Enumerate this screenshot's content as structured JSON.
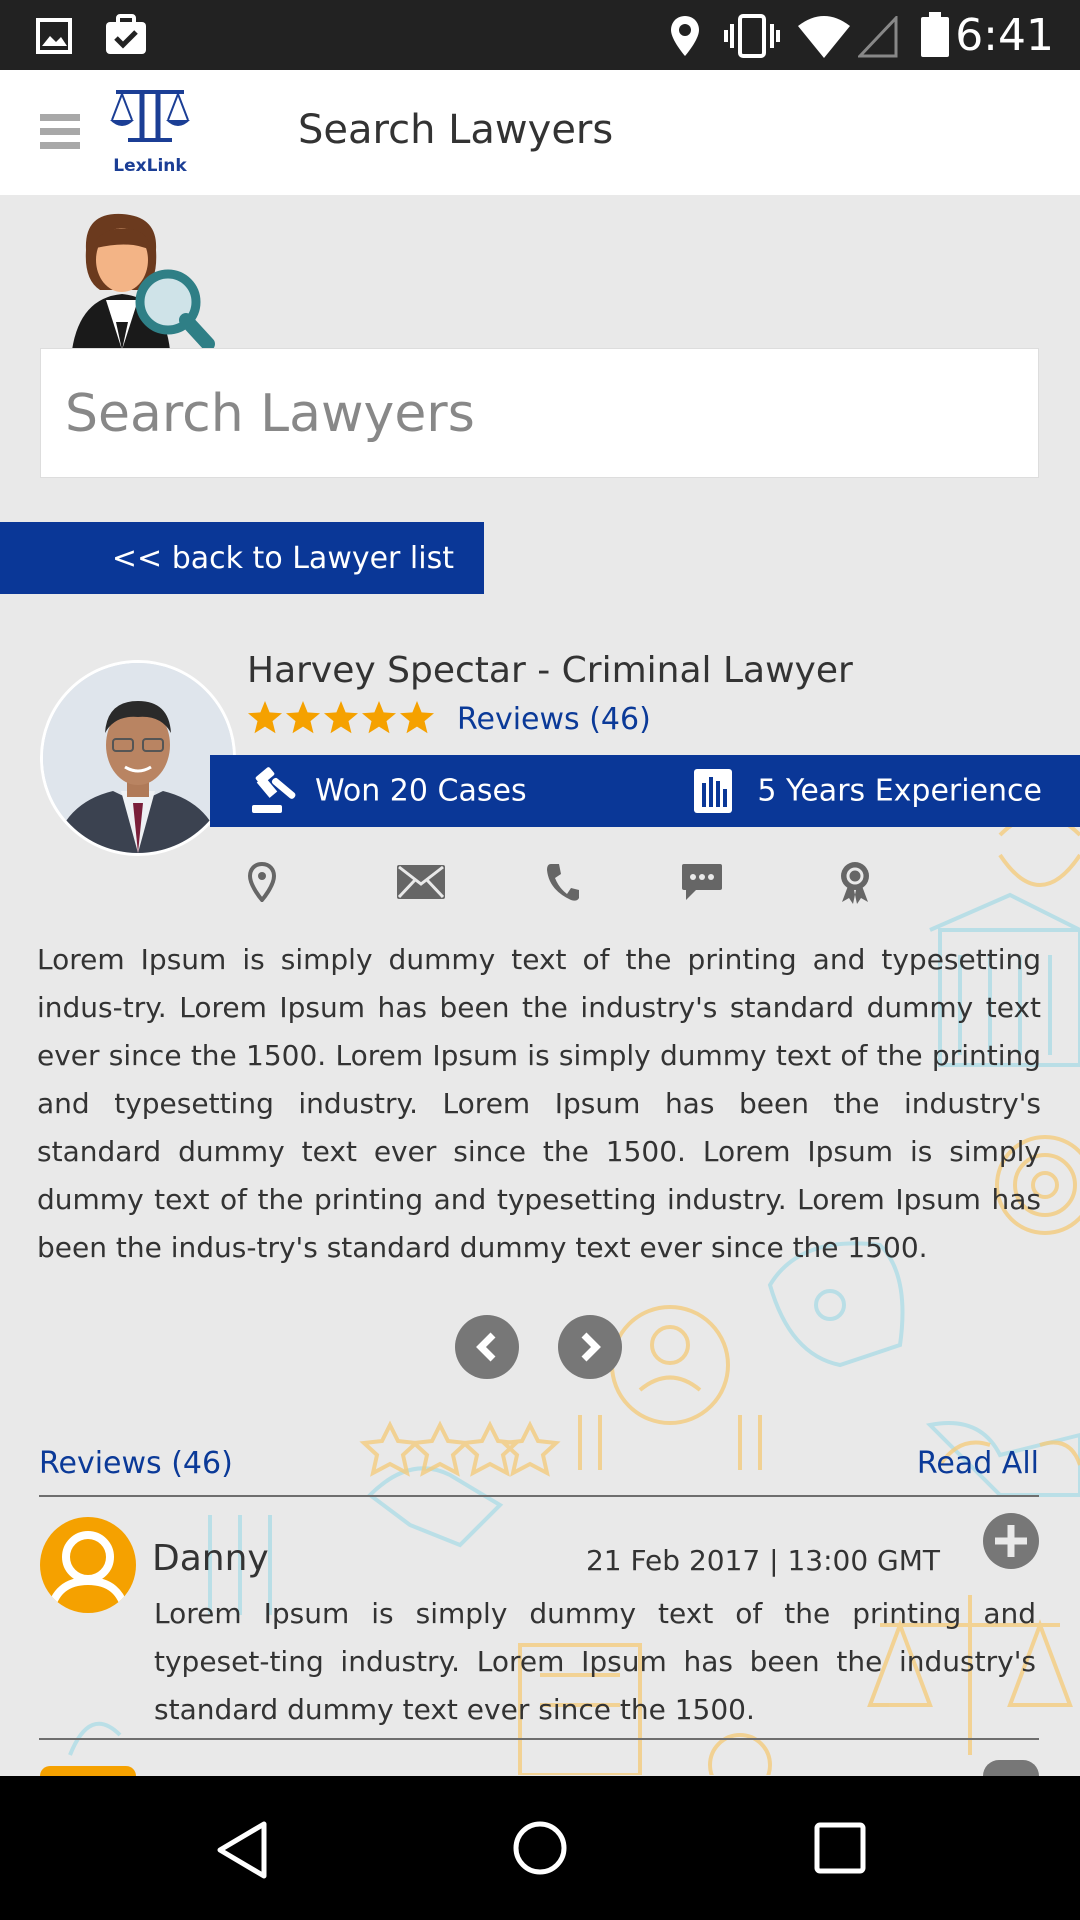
{
  "status_bar": {
    "time": "6:41"
  },
  "app_bar": {
    "title": "Search Lawyers",
    "logo_text": "LexLink"
  },
  "search": {
    "placeholder": "Search Lawyers"
  },
  "back_button": {
    "label": "<< back to Lawyer list"
  },
  "profile": {
    "name": "Harvey Spectar - Criminal Lawyer",
    "rating": 5,
    "reviews_label": "Reviews (46)",
    "won_cases": "Won 20 Cases",
    "experience": "5 Years Experience",
    "contact_icons": [
      "location-icon",
      "mail-icon",
      "phone-icon",
      "chat-icon",
      "award-icon"
    ],
    "description": "Lorem Ipsum is simply dummy text of the printing and typesetting indus-try. Lorem Ipsum has been the industry's standard dummy text ever since the 1500. Lorem Ipsum is simply dummy text of the printing and typesetting industry. Lorem Ipsum has been the industry's standard dummy text ever since the 1500. Lorem Ipsum is simply dummy text of the printing and typesetting industry. Lorem Ipsum has been the indus-try's standard dummy text ever since the 1500."
  },
  "reviews": {
    "header": "Reviews (46)",
    "read_all": "Read All",
    "items": [
      {
        "name": "Danny",
        "date": "21 Feb 2017 | 13:00 GMT",
        "text": "Lorem Ipsum is simply dummy text of the printing and typeset-ting industry. Lorem Ipsum has been the industry's standard dummy text ever since the 1500."
      }
    ]
  },
  "colors": {
    "primary_blue": "#0a3797",
    "link_blue": "#0b3a98",
    "star": "#f5a100",
    "background": "#e9e9e9"
  }
}
